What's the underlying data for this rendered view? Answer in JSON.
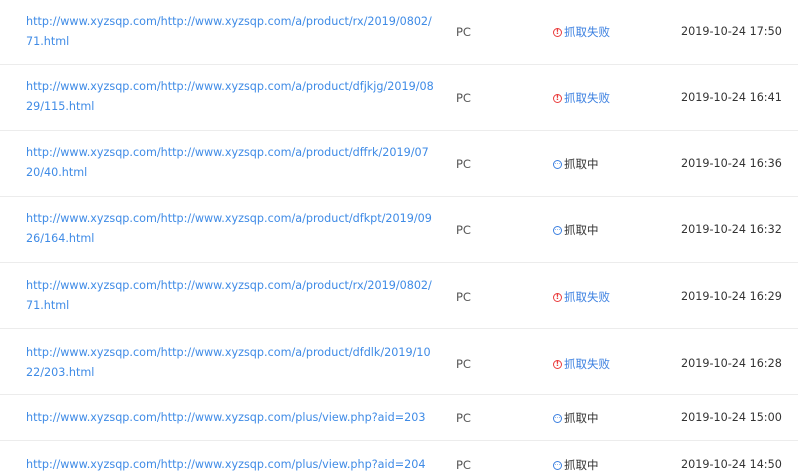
{
  "rows": [
    {
      "url": "http://www.xyzsqp.com/http://www.xyzsqp.com/a/product/rx/2019/0802/71.html",
      "device": "PC",
      "status": "抓取失败",
      "status_type": "fail",
      "time": "2019-10-24 17:50"
    },
    {
      "url": "http://www.xyzsqp.com/http://www.xyzsqp.com/a/product/dfjkjg/2019/0829/115.html",
      "device": "PC",
      "status": "抓取失败",
      "status_type": "fail",
      "time": "2019-10-24 16:41"
    },
    {
      "url": "http://www.xyzsqp.com/http://www.xyzsqp.com/a/product/dffrk/2019/0720/40.html",
      "device": "PC",
      "status": "抓取中",
      "status_type": "pending",
      "time": "2019-10-24 16:36"
    },
    {
      "url": "http://www.xyzsqp.com/http://www.xyzsqp.com/a/product/dfkpt/2019/0926/164.html",
      "device": "PC",
      "status": "抓取中",
      "status_type": "pending",
      "time": "2019-10-24 16:32"
    },
    {
      "url": "http://www.xyzsqp.com/http://www.xyzsqp.com/a/product/rx/2019/0802/71.html",
      "device": "PC",
      "status": "抓取失败",
      "status_type": "fail",
      "time": "2019-10-24 16:29"
    },
    {
      "url": "http://www.xyzsqp.com/http://www.xyzsqp.com/a/product/dfdlk/2019/1022/203.html",
      "device": "PC",
      "status": "抓取失败",
      "status_type": "fail",
      "time": "2019-10-24 16:28"
    },
    {
      "url": "http://www.xyzsqp.com/http://www.xyzsqp.com/plus/view.php?aid=203",
      "device": "PC",
      "status": "抓取中",
      "status_type": "pending",
      "time": "2019-10-24 15:00"
    },
    {
      "url": "http://www.xyzsqp.com/http://www.xyzsqp.com/plus/view.php?aid=204",
      "device": "PC",
      "status": "抓取中",
      "status_type": "pending",
      "time": "2019-10-24 14:50"
    }
  ]
}
